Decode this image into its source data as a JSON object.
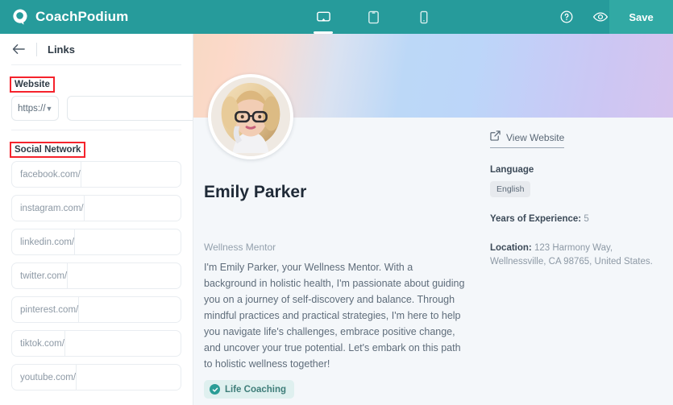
{
  "topbar": {
    "brand_name": "CoachPodium",
    "brand_icon": "speech-bubble-logo-icon",
    "device_tabs": [
      {
        "name": "desktop",
        "icon": "monitor-icon",
        "active": true
      },
      {
        "name": "tablet",
        "icon": "tablet-icon",
        "active": false
      },
      {
        "name": "mobile",
        "icon": "mobile-icon",
        "active": false
      }
    ],
    "help_icon": "question-circle-icon",
    "preview_icon": "eye-icon",
    "save_label": "Save",
    "accent_color": "#269b9b",
    "save_bg": "#31a9a4"
  },
  "sidebar": {
    "back_icon": "arrow-left-icon",
    "title": "Links",
    "website": {
      "label": "Website",
      "annotated": true,
      "prefix_value": "https://",
      "prefix_icon": "chevron-down-icon",
      "url_value": "",
      "url_placeholder": ""
    },
    "social": {
      "label": "Social Network",
      "annotated": true,
      "fields": [
        {
          "prefix": "facebook.com/",
          "value": "",
          "name": "facebook"
        },
        {
          "prefix": "instagram.com/",
          "value": "",
          "name": "instagram"
        },
        {
          "prefix": "linkedin.com/",
          "value": "",
          "name": "linkedin"
        },
        {
          "prefix": "twitter.com/",
          "value": "",
          "name": "twitter"
        },
        {
          "prefix": "pinterest.com/",
          "value": "",
          "name": "pinterest"
        },
        {
          "prefix": "tiktok.com/",
          "value": "",
          "name": "tiktok"
        },
        {
          "prefix": "youtube.com/",
          "value": "",
          "name": "youtube"
        }
      ]
    },
    "annotation_color": "#f5232c"
  },
  "preview": {
    "avatar_alt": "profile-photo",
    "name": "Emily Parker",
    "role": "Wellness Mentor",
    "bio": "I'm Emily Parker, your Wellness Mentor. With a background in holistic health, I'm passionate about guiding you on a journey of self-discovery and balance. Through mindful practices and practical strategies, I'm here to help you navigate life's challenges, embrace positive change, and uncover your true potential. Let's embark on this path to holistic wellness together!",
    "badge": {
      "label": "Life Coaching",
      "icon": "check-circle-icon"
    },
    "info": {
      "view_website_label": "View Website",
      "view_website_icon": "external-link-icon",
      "language_label": "Language",
      "language_value": "English",
      "experience_label": "Years of Experience:",
      "experience_value": "5",
      "location_label": "Location:",
      "location_value": "123 Harmony Way, Wellnessville, CA 98765, United States."
    }
  }
}
